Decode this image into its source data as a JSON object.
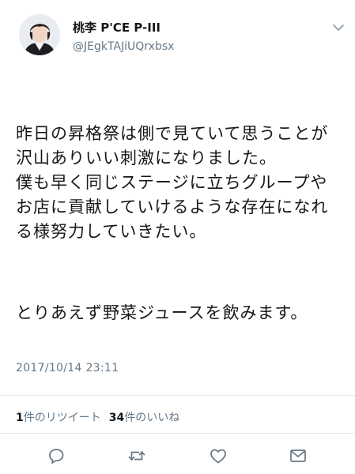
{
  "user": {
    "display_name": "桃李 P'CE P-III",
    "handle": "@JEgkTAJiUQrxbsx"
  },
  "tweet": {
    "paragraphs": [
      "昨日の昇格祭は側で見ていて思うことが沢山ありいい刺激になりました。\n僕も早く同じステージに立ちグループやお店に貢献していけるような存在になれる様努力していきたい。",
      "とりあえず野菜ジュースを飲みます。"
    ],
    "timestamp": "2017/10/14 23:11"
  },
  "stats": {
    "retweet_count": "1",
    "retweet_label": "件のリツイート",
    "like_count": "34",
    "like_label": "件のいいね"
  },
  "icons": [
    "chevron-down-icon",
    "reply-icon",
    "retweet-icon",
    "like-icon",
    "dm-icon"
  ],
  "colors": {
    "text": "#14171a",
    "secondary": "#657786",
    "border": "#e1e8ed",
    "icon": "#657786"
  }
}
